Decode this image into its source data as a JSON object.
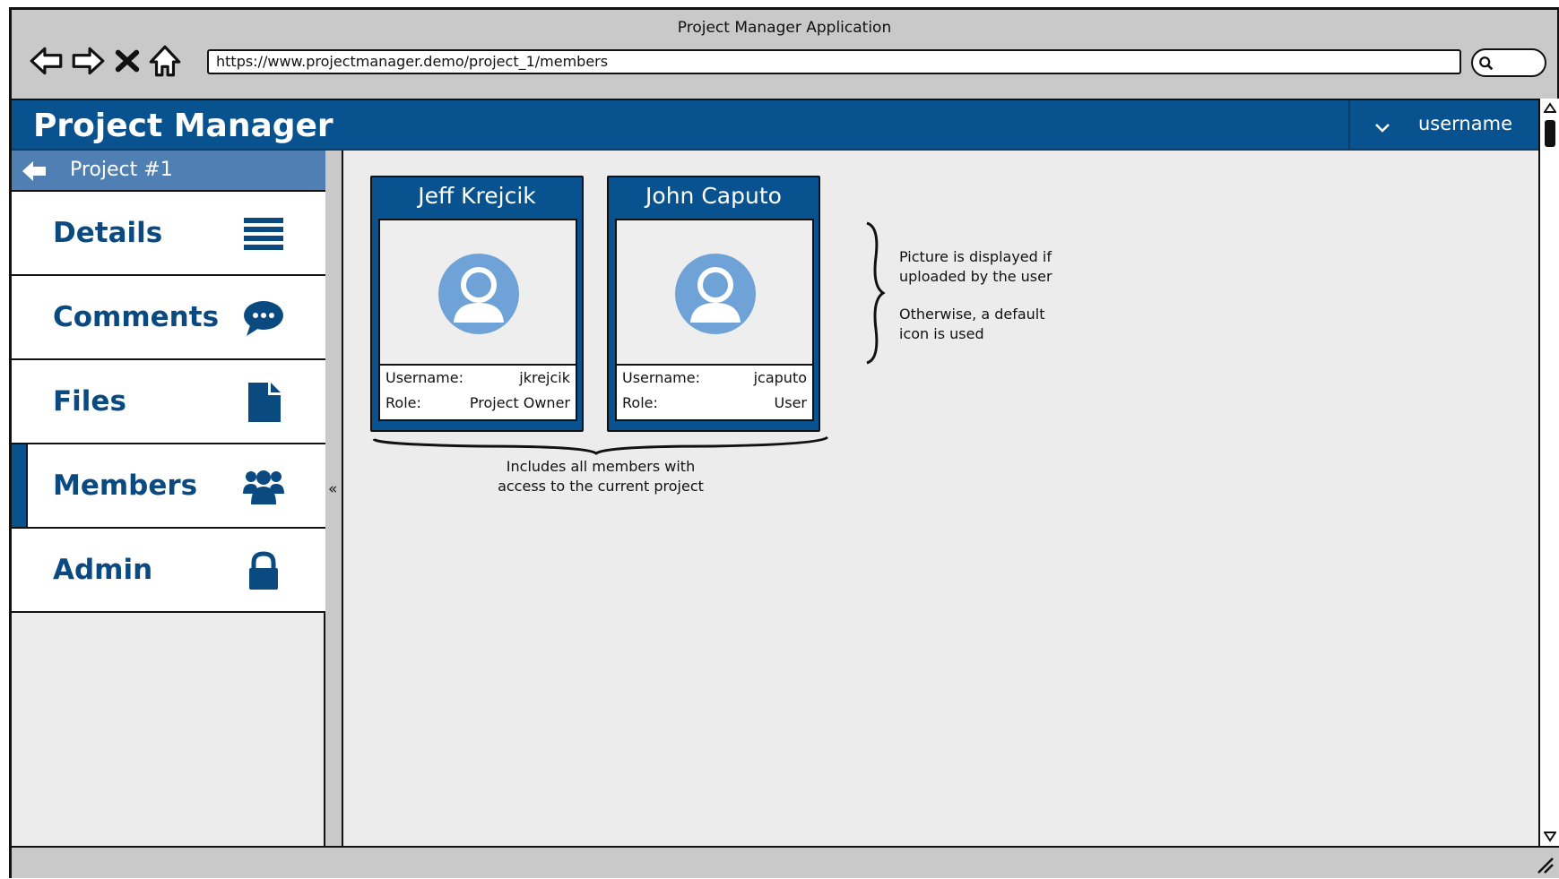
{
  "window": {
    "title": "Project Manager Application"
  },
  "browser": {
    "url": "https://www.projectmanager.demo/project_1/members",
    "nav": [
      "back-icon",
      "forward-icon",
      "close-icon",
      "home-icon"
    ]
  },
  "app": {
    "title": "Project Manager",
    "user_menu": {
      "label": "username"
    },
    "accent": "#08538f"
  },
  "sidebar": {
    "back_label": "Project #1",
    "collapse_glyph": "«",
    "items": [
      {
        "label": "Details",
        "icon": "list-icon"
      },
      {
        "label": "Comments",
        "icon": "comment-icon"
      },
      {
        "label": "Files",
        "icon": "file-icon"
      },
      {
        "label": "Members",
        "icon": "users-icon",
        "active": true
      },
      {
        "label": "Admin",
        "icon": "lock-icon"
      }
    ]
  },
  "members": [
    {
      "name": "Jeff Krejcik",
      "username_label": "Username:",
      "username": "jkrejcik",
      "role_label": "Role:",
      "role": "Project Owner"
    },
    {
      "name": "John Caputo",
      "username_label": "Username:",
      "username": "jcaputo",
      "role_label": "Role:",
      "role": "User"
    }
  ],
  "annotations": {
    "picture_note_line1": "Picture is displayed if",
    "picture_note_line2": "uploaded by the user",
    "default_note_line1": "Otherwise, a default",
    "default_note_line2": "icon is used",
    "members_note_line1": "Includes all members with",
    "members_note_line2": "access to the current project"
  }
}
